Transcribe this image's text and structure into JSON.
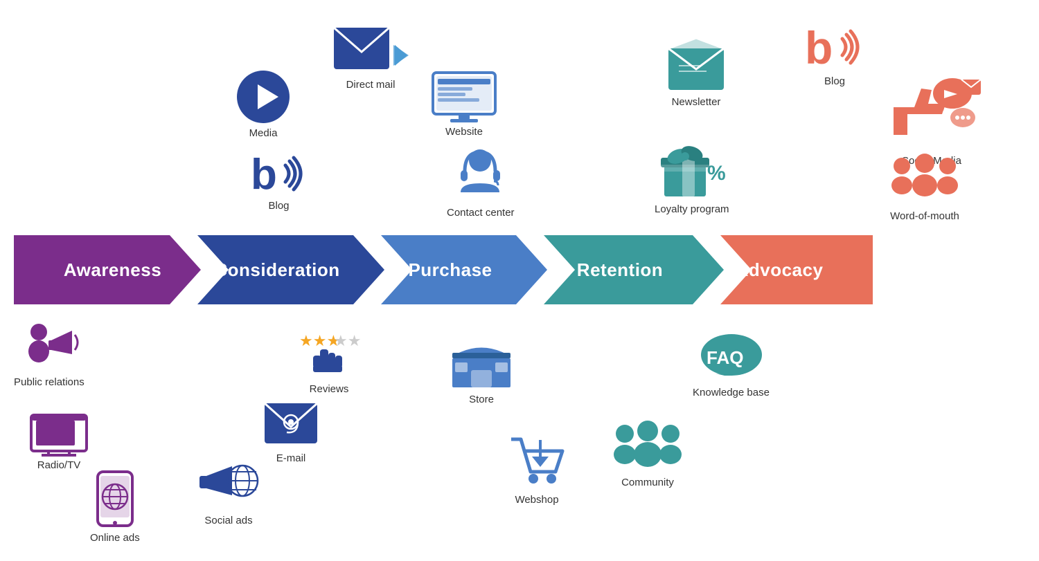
{
  "arrows": [
    {
      "id": "awareness",
      "label": "Awareness",
      "color": "#7B2D8B"
    },
    {
      "id": "consideration",
      "label": "Consideration",
      "color": "#2B4899"
    },
    {
      "id": "purchase",
      "label": "Purchase",
      "color": "#4A7EC7"
    },
    {
      "id": "retention",
      "label": "Retention",
      "color": "#3A9B9B"
    },
    {
      "id": "advocacy",
      "label": "Advocacy",
      "color": "#E8705A"
    }
  ],
  "icons": {
    "public_relations": "Public relations",
    "radio_tv": "Radio/TV",
    "online_ads": "Online ads",
    "direct_mail": "Direct mail",
    "media": "Media",
    "blog_consideration": "Blog",
    "reviews": "Reviews",
    "email": "E-mail",
    "social_ads": "Social ads",
    "website": "Website",
    "contact_center": "Contact center",
    "store": "Store",
    "webshop": "Webshop",
    "newsletter": "Newsletter",
    "loyalty_program": "Loyalty program",
    "knowledge_base": "Knowledge base",
    "community": "Community",
    "blog_advocacy": "Blog",
    "social_media": "Social Media",
    "word_of_mouth": "Word-of-mouth"
  }
}
